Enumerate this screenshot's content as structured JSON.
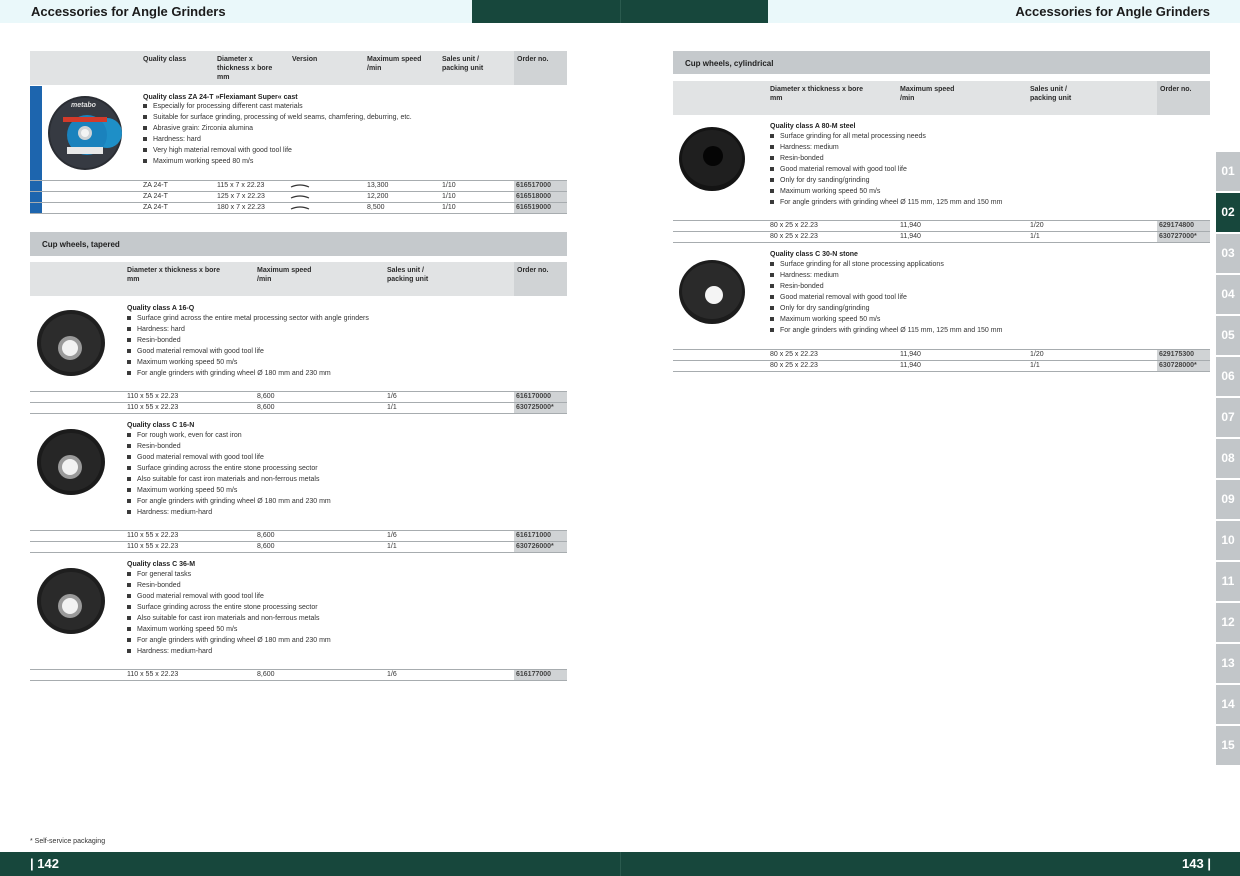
{
  "header": {
    "left_title": "Accessories for Angle Grinders",
    "right_title": "Accessories for Angle Grinders",
    "colors": {
      "light": "#eaf8fa",
      "dark": "#17473c"
    }
  },
  "footer": {
    "footnote": "* Self-service packaging",
    "left_page": "| 142",
    "right_page": "143 |"
  },
  "side_tabs": [
    "01",
    "02",
    "03",
    "04",
    "05",
    "06",
    "07",
    "08",
    "09",
    "10",
    "11",
    "12",
    "13",
    "14",
    "15"
  ],
  "active_tab": "02",
  "top_table": {
    "headers": {
      "quality": "Quality class",
      "dims": "Diameter x\nthickness x bore\nmm",
      "version": "Version",
      "speed": "Maximum speed\n/min",
      "sales": "Sales unit /\npacking unit",
      "order": "Order no."
    },
    "product": {
      "title": "Quality class ZA 24-T »Flexiamant Super« cast",
      "bullets": [
        "Especially for processing different cast materials",
        "Suitable for surface grinding, processing of weld seams, chamfering, deburring, etc.",
        "Abrasive grain: Zirconia alumina",
        "Hardness: hard",
        "Very high material removal with good tool life",
        "Maximum working speed 80 m/s"
      ],
      "label_text": "metabo",
      "rows": [
        {
          "quality": "ZA 24-T",
          "dims": "115 x 7 x 22.23",
          "speed": "13,300",
          "sales": "1/10",
          "order": "616517000"
        },
        {
          "quality": "ZA 24-T",
          "dims": "125 x 7 x 22.23",
          "speed": "12,200",
          "sales": "1/10",
          "order": "616518000"
        },
        {
          "quality": "ZA 24-T",
          "dims": "180 x 7 x 22.23",
          "speed": "8,500",
          "sales": "1/10",
          "order": "616519000"
        }
      ]
    }
  },
  "tapered": {
    "section_title": "Cup wheels, tapered",
    "headers": {
      "dims": "Diameter x thickness x bore\nmm",
      "speed": "Maximum speed\n/min",
      "sales": "Sales unit /\npacking unit",
      "order": "Order no."
    },
    "products": [
      {
        "title": "Quality class A 16-Q",
        "bullets": [
          "Surface grind across the entire metal processing sector with angle grinders",
          "Hardness: hard",
          "Resin-bonded",
          "Good material removal with good tool life",
          "Maximum working speed 50 m/s",
          "For angle grinders with grinding wheel Ø 180 mm and 230 mm"
        ],
        "rows": [
          {
            "dims": "110 x 55 x 22.23",
            "speed": "8,600",
            "sales": "1/6",
            "order": "616170000"
          },
          {
            "dims": "110 x 55 x 22.23",
            "speed": "8,600",
            "sales": "1/1",
            "order": "630725000*"
          }
        ]
      },
      {
        "title": "Quality class C 16-N",
        "bullets": [
          "For rough work, even for cast iron",
          "Resin-bonded",
          "Good material removal with good tool life",
          "Surface grinding across the entire stone processing sector",
          "Also suitable for cast iron materials and non-ferrous metals",
          "Maximum working speed 50 m/s",
          "For angle grinders with grinding wheel Ø 180 mm and 230 mm",
          "Hardness: medium-hard"
        ],
        "rows": [
          {
            "dims": "110 x 55 x 22.23",
            "speed": "8,600",
            "sales": "1/6",
            "order": "616171000"
          },
          {
            "dims": "110 x 55 x 22.23",
            "speed": "8,600",
            "sales": "1/1",
            "order": "630726000*"
          }
        ]
      },
      {
        "title": "Quality class C 36-M",
        "bullets": [
          "For general tasks",
          "Resin-bonded",
          "Good material removal with good tool life",
          "Surface grinding across the entire stone processing sector",
          "Also suitable for cast iron materials and non-ferrous metals",
          "Maximum working speed 50 m/s",
          "For angle grinders with grinding wheel Ø 180 mm and 230 mm",
          "Hardness: medium-hard"
        ],
        "rows": [
          {
            "dims": "110 x 55 x 22.23",
            "speed": "8,600",
            "sales": "1/6",
            "order": "616177000"
          }
        ]
      }
    ]
  },
  "cylindrical": {
    "section_title": "Cup wheels, cylindrical",
    "headers": {
      "dims": "Diameter x thickness x bore\nmm",
      "speed": "Maximum speed\n/min",
      "sales": "Sales unit /\npacking unit",
      "order": "Order no."
    },
    "products": [
      {
        "title": "Quality class A 80-M steel",
        "bullets": [
          "Surface grinding for all metal processing needs",
          "Hardness: medium",
          "Resin-bonded",
          "Good material removal with good tool life",
          "Only for dry sanding/grinding",
          "Maximum working speed 50 m/s",
          "For angle grinders with grinding wheel Ø 115 mm, 125 mm and 150 mm"
        ],
        "rows": [
          {
            "dims": "80 x 25 x 22.23",
            "speed": "11,940",
            "sales": "1/20",
            "order": "629174800"
          },
          {
            "dims": "80 x 25 x 22.23",
            "speed": "11,940",
            "sales": "1/1",
            "order": "630727000*"
          }
        ]
      },
      {
        "title": "Quality class C 30-N stone",
        "bullets": [
          "Surface grinding for all stone processing applications",
          "Hardness: medium",
          "Resin-bonded",
          "Good material removal with good tool life",
          "Only for dry sanding/grinding",
          "Maximum working speed 50 m/s",
          "For angle grinders with grinding wheel Ø 115 mm, 125 mm and 150 mm"
        ],
        "rows": [
          {
            "dims": "80 x 25 x 22.23",
            "speed": "11,940",
            "sales": "1/20",
            "order": "629175300"
          },
          {
            "dims": "80 x 25 x 22.23",
            "speed": "11,940",
            "sales": "1/1",
            "order": "630728000*"
          }
        ]
      }
    ]
  }
}
